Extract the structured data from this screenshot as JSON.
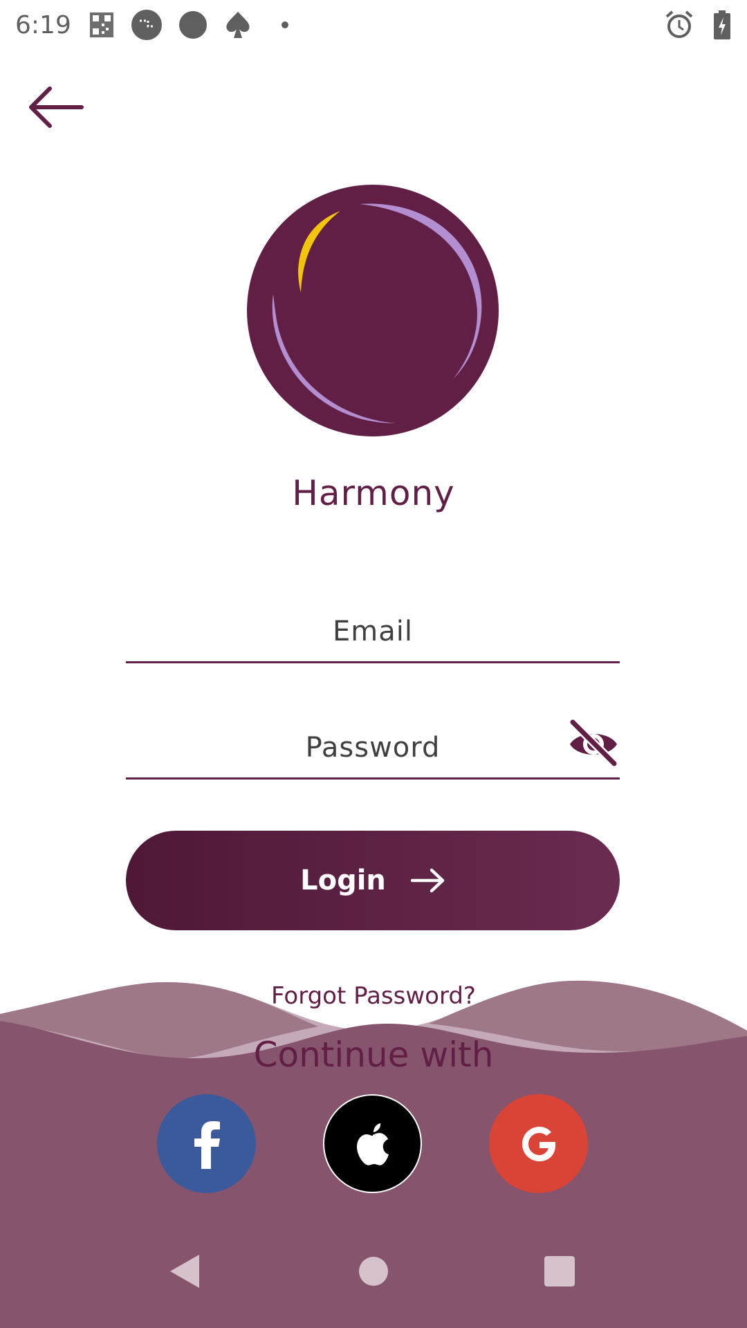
{
  "status_bar": {
    "time": "6:19",
    "icons": [
      "qr-code-icon",
      "chat-bubble-icon",
      "circle-icon",
      "spade-icon",
      "dot-icon",
      "alarm-icon",
      "battery-charging-icon"
    ]
  },
  "header": {
    "back_icon": "arrow-left-icon"
  },
  "app": {
    "title": "Harmony"
  },
  "form": {
    "email_placeholder": "Email",
    "password_placeholder": "Password",
    "toggle_icon": "eye-off-icon"
  },
  "login": {
    "label": "Login",
    "icon": "arrow-right-icon"
  },
  "forgot_password": "Forgot Password?",
  "continue_with": "Continue with",
  "social": [
    {
      "name": "facebook",
      "icon": "facebook-icon",
      "color": "#3b5a9c"
    },
    {
      "name": "apple",
      "icon": "apple-icon",
      "color": "#000000"
    },
    {
      "name": "google",
      "icon": "google-icon",
      "color": "#da4437"
    }
  ],
  "colors": {
    "primary": "#611f45",
    "logo_ring": "#b38fd1",
    "logo_accent": "#f2c40b",
    "wave_light": "#c4a9b9",
    "wave_mid": "#9e7789",
    "bottom": "#86546c"
  },
  "nav_bar": {
    "icons": [
      "nav-back-icon",
      "nav-home-icon",
      "nav-recents-icon"
    ]
  }
}
